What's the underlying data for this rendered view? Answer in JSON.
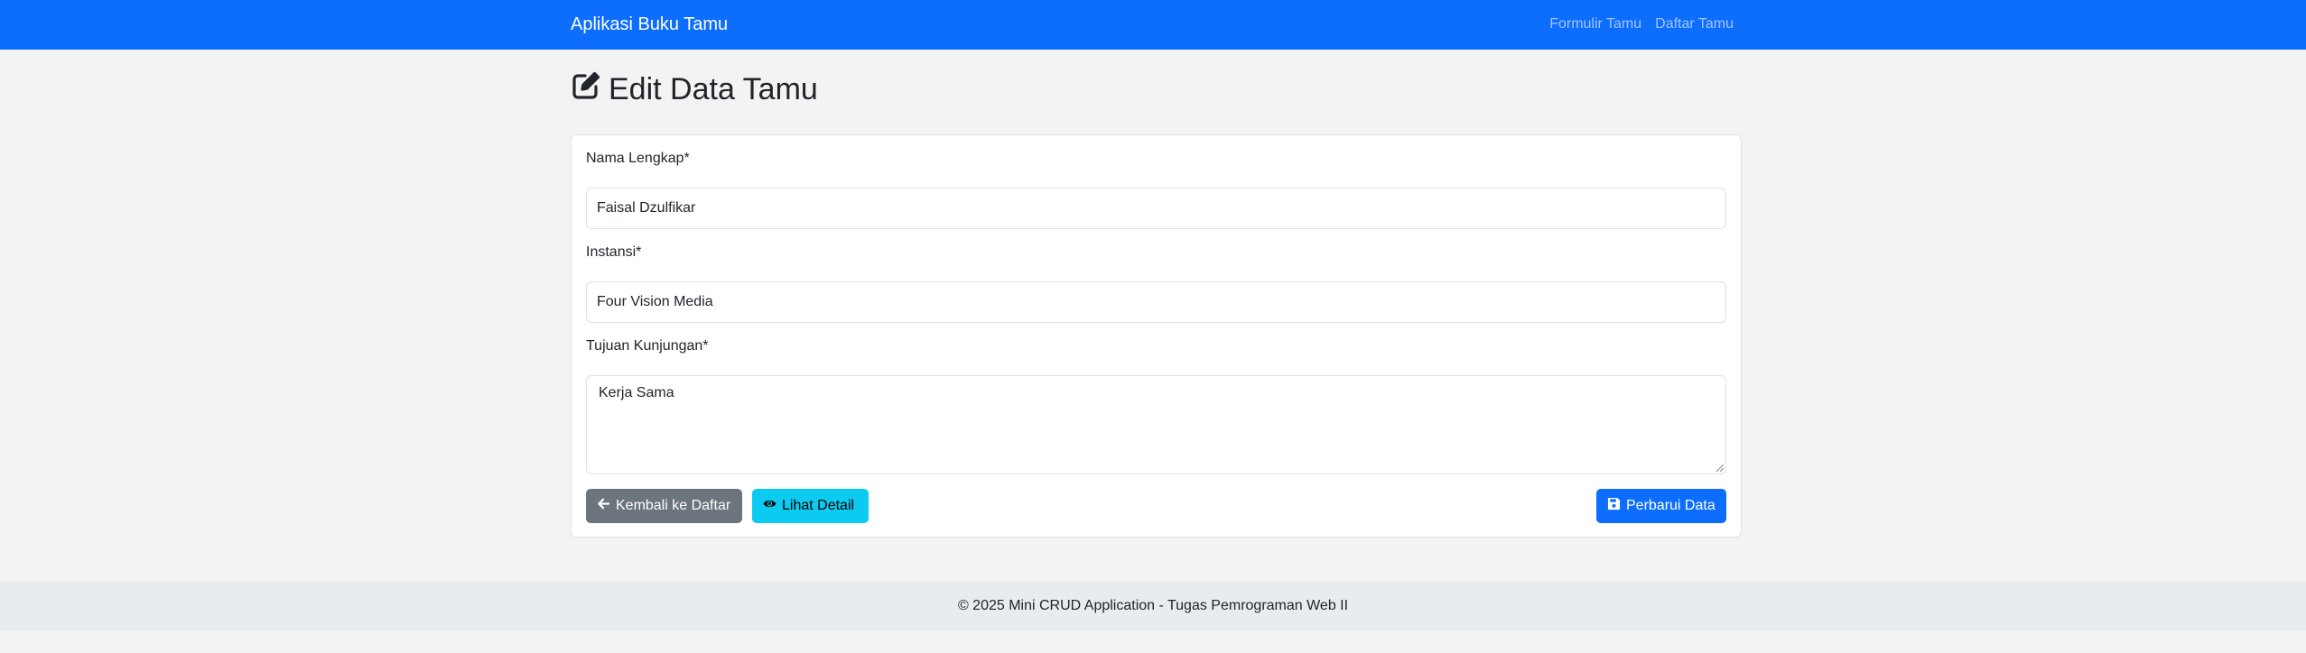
{
  "navbar": {
    "brand": "Aplikasi Buku Tamu",
    "links": [
      "Formulir Tamu",
      "Daftar Tamu"
    ]
  },
  "page": {
    "title": "Edit Data Tamu",
    "title_icon": "edit-icon"
  },
  "form": {
    "nama": {
      "label": "Nama Lengkap*",
      "value": "Faisal Dzulfikar"
    },
    "instansi": {
      "label": "Instansi*",
      "value": "Four Vision Media"
    },
    "tujuan": {
      "label": "Tujuan Kunjungan*",
      "value": "Kerja Sama"
    }
  },
  "buttons": {
    "back": {
      "label": "Kembali ke Daftar",
      "icon": "arrow-left-icon"
    },
    "detail": {
      "label": "Lihat Detail",
      "icon": "eye-icon"
    },
    "update": {
      "label": "Perbarui Data",
      "icon": "save-icon"
    }
  },
  "footer": {
    "text": "© 2025 Mini CRUD Application - Tugas Pemrograman Web II"
  },
  "colors": {
    "primary": "#0d6efd",
    "secondary": "#6c757d",
    "info": "#0dcaf0",
    "background": "#f3f3f3",
    "footer_bg": "#e9ecef"
  }
}
